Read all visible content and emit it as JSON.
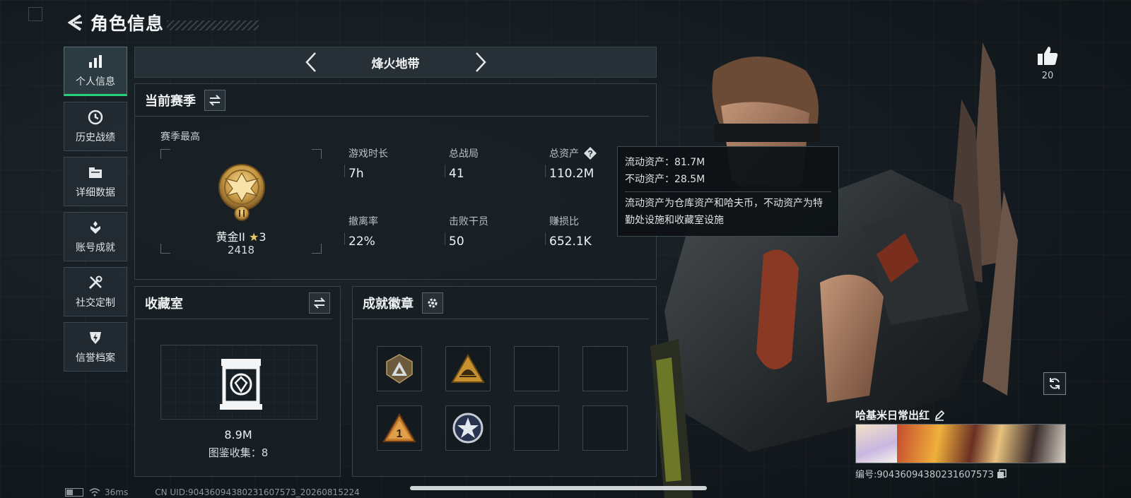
{
  "header": {
    "title": "角色信息"
  },
  "nav": {
    "items": [
      {
        "label": "个人信息",
        "icon": "bar-chart-icon",
        "active": true
      },
      {
        "label": "历史战绩",
        "icon": "clock-icon"
      },
      {
        "label": "详细数据",
        "icon": "folder-icon"
      },
      {
        "label": "账号成就",
        "icon": "achievement-icon"
      },
      {
        "label": "社交定制",
        "icon": "tools-icon"
      },
      {
        "label": "信誉档案",
        "icon": "shield-icon"
      }
    ]
  },
  "mode": {
    "name": "烽火地带"
  },
  "season": {
    "title": "当前赛季",
    "best_label": "赛季最高",
    "rank_name": "黄金II",
    "rank_stars": "3",
    "rank_score": "2418",
    "stats": [
      {
        "label": "游戏时长",
        "value": "7h"
      },
      {
        "label": "总战局",
        "value": "41"
      },
      {
        "label": "总资产",
        "value": "110.2M"
      },
      {
        "label": "撤离率",
        "value": "22%"
      },
      {
        "label": "击败干员",
        "value": "50"
      },
      {
        "label": "赚损比",
        "value": "652.1K"
      }
    ]
  },
  "tooltip": {
    "liquid": "流动资产：81.7M",
    "fixed": "不动资产：28.5M",
    "desc": "流动资产为仓库资产和哈夫币，不动资产为特勤处设施和收藏室设施"
  },
  "collection": {
    "title": "收藏室",
    "value": "8.9M",
    "count_label": "图鉴收集：",
    "count": "8"
  },
  "badges": {
    "title": "成就徽章",
    "items": [
      "badge-triangle-silver",
      "badge-triangle-dome",
      "empty",
      "empty",
      "badge-triangle-one",
      "badge-star-round",
      "empty",
      "empty"
    ]
  },
  "player": {
    "likes": "20",
    "name": "哈基米日常出红",
    "id": "编号:9043609438023160757З"
  },
  "footer": {
    "ping": "36ms",
    "uid": "CN UID:9043609438023160757З_20260815224"
  },
  "colors": {
    "accent": "#27d17a",
    "gold": "#c89a45",
    "panel": "#18232a"
  }
}
